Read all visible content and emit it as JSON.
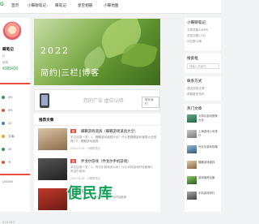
{
  "header": {
    "logo": "G",
    "nav": [
      {
        "label": "首页",
        "caret": false
      },
      {
        "label": "小蝶聊笔记",
        "caret": true
      },
      {
        "label": "蝶笔记",
        "caret": false
      },
      {
        "label": "星空相册",
        "caret": false
      },
      {
        "label": "小蝶地图",
        "caret": false
      }
    ]
  },
  "sidebar_left": {
    "name": "蝶笔记",
    "line1": "G",
    "count_label": "访问",
    "count_value": "4380430",
    "rows": [
      "4%",
      "5%",
      "23",
      "文库(",
      "15",
      "%"
    ],
    "more": "(2024/5/",
    "footer": "1 / 2 / 5 1"
  },
  "banner": {
    "year": "2022",
    "slogan": "简约|三栏|博客"
  },
  "ad": {
    "text": "您的广告 虚位以待",
    "button": "联系我们"
  },
  "feed": {
    "heading": "推荐文章",
    "items": [
      {
        "tag": "推",
        "title": "蝶籁游戏道具（蝶籁游戏道具大全）",
        "desc": "本文目录一览：1、蝶籁游戏道具大全？什么是蝶籁游戏道具大全推荐？2、蝶籁游戏道具",
        "meta": "2023-03-18 · 小蝶聊笔记"
      },
      {
        "tag": "推",
        "title": "乔戈尔游戏（乔戈尔手机游戏）",
        "desc": "本文目录一览：1、乔戈尔游戏怎么玩？什么手机游戏好玩推荐2、乔戈尔游戏",
        "meta": "2023-03-18 · 小蝶聊笔记"
      },
      {
        "tag": "推",
        "title": "游戏推荐",
        "desc": "本文目录一览：游戏推荐 什么游戏好玩推荐",
        "meta": "2023-03-18 · 小蝶聊笔记"
      }
    ]
  },
  "watermark": "便民库",
  "sidebar_right": {
    "card1_title": "小蝶聊笔记",
    "card1_lines": [
      "文章总数1190列",
      "浏览次数1.2万",
      "评论数32条"
    ],
    "search_placeholder": "请输入关键词",
    "card2_title": "搜索框",
    "card3_title": "联系方式",
    "card3_lines": [
      "提交您的文章",
      "获取更多资讯"
    ],
    "card4_title": "热门文章",
    "hot": [
      "卡特尔游戏推荐大全",
      "上海游戏公司排行",
      "乔戈尔游戏攻略",
      "蝶籁游戏道具",
      "游戏推荐合集",
      "手机游戏排行"
    ]
  },
  "colors": {
    "accent": "#2a9d4b",
    "tag": "#e94b3c",
    "watermark": "#12a25a"
  }
}
